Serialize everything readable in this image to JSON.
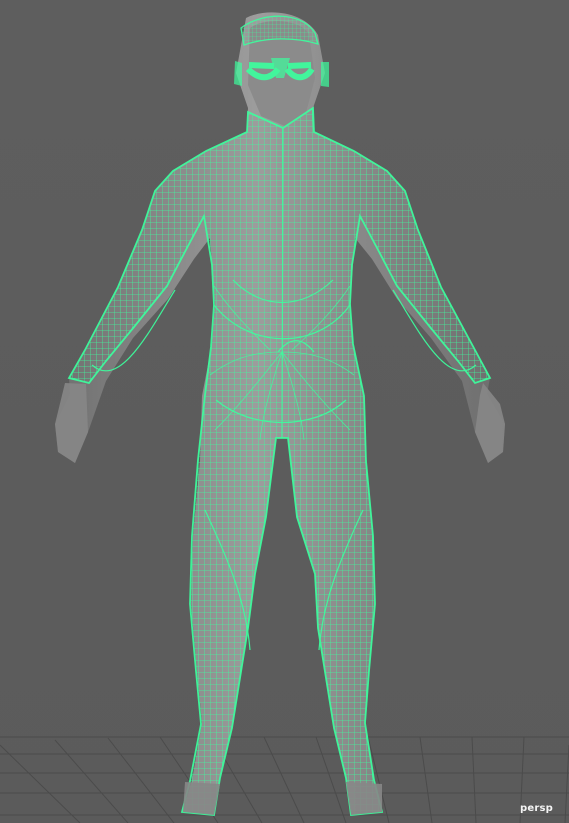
{
  "viewport": {
    "camera_label": "persp"
  },
  "colors": {
    "background": "#5d5d5d",
    "grid": "#4a4a4a",
    "skin": "#8f8f8f",
    "skin_shadow": "#6f6f6f",
    "wireframe": "#3cff9e"
  }
}
